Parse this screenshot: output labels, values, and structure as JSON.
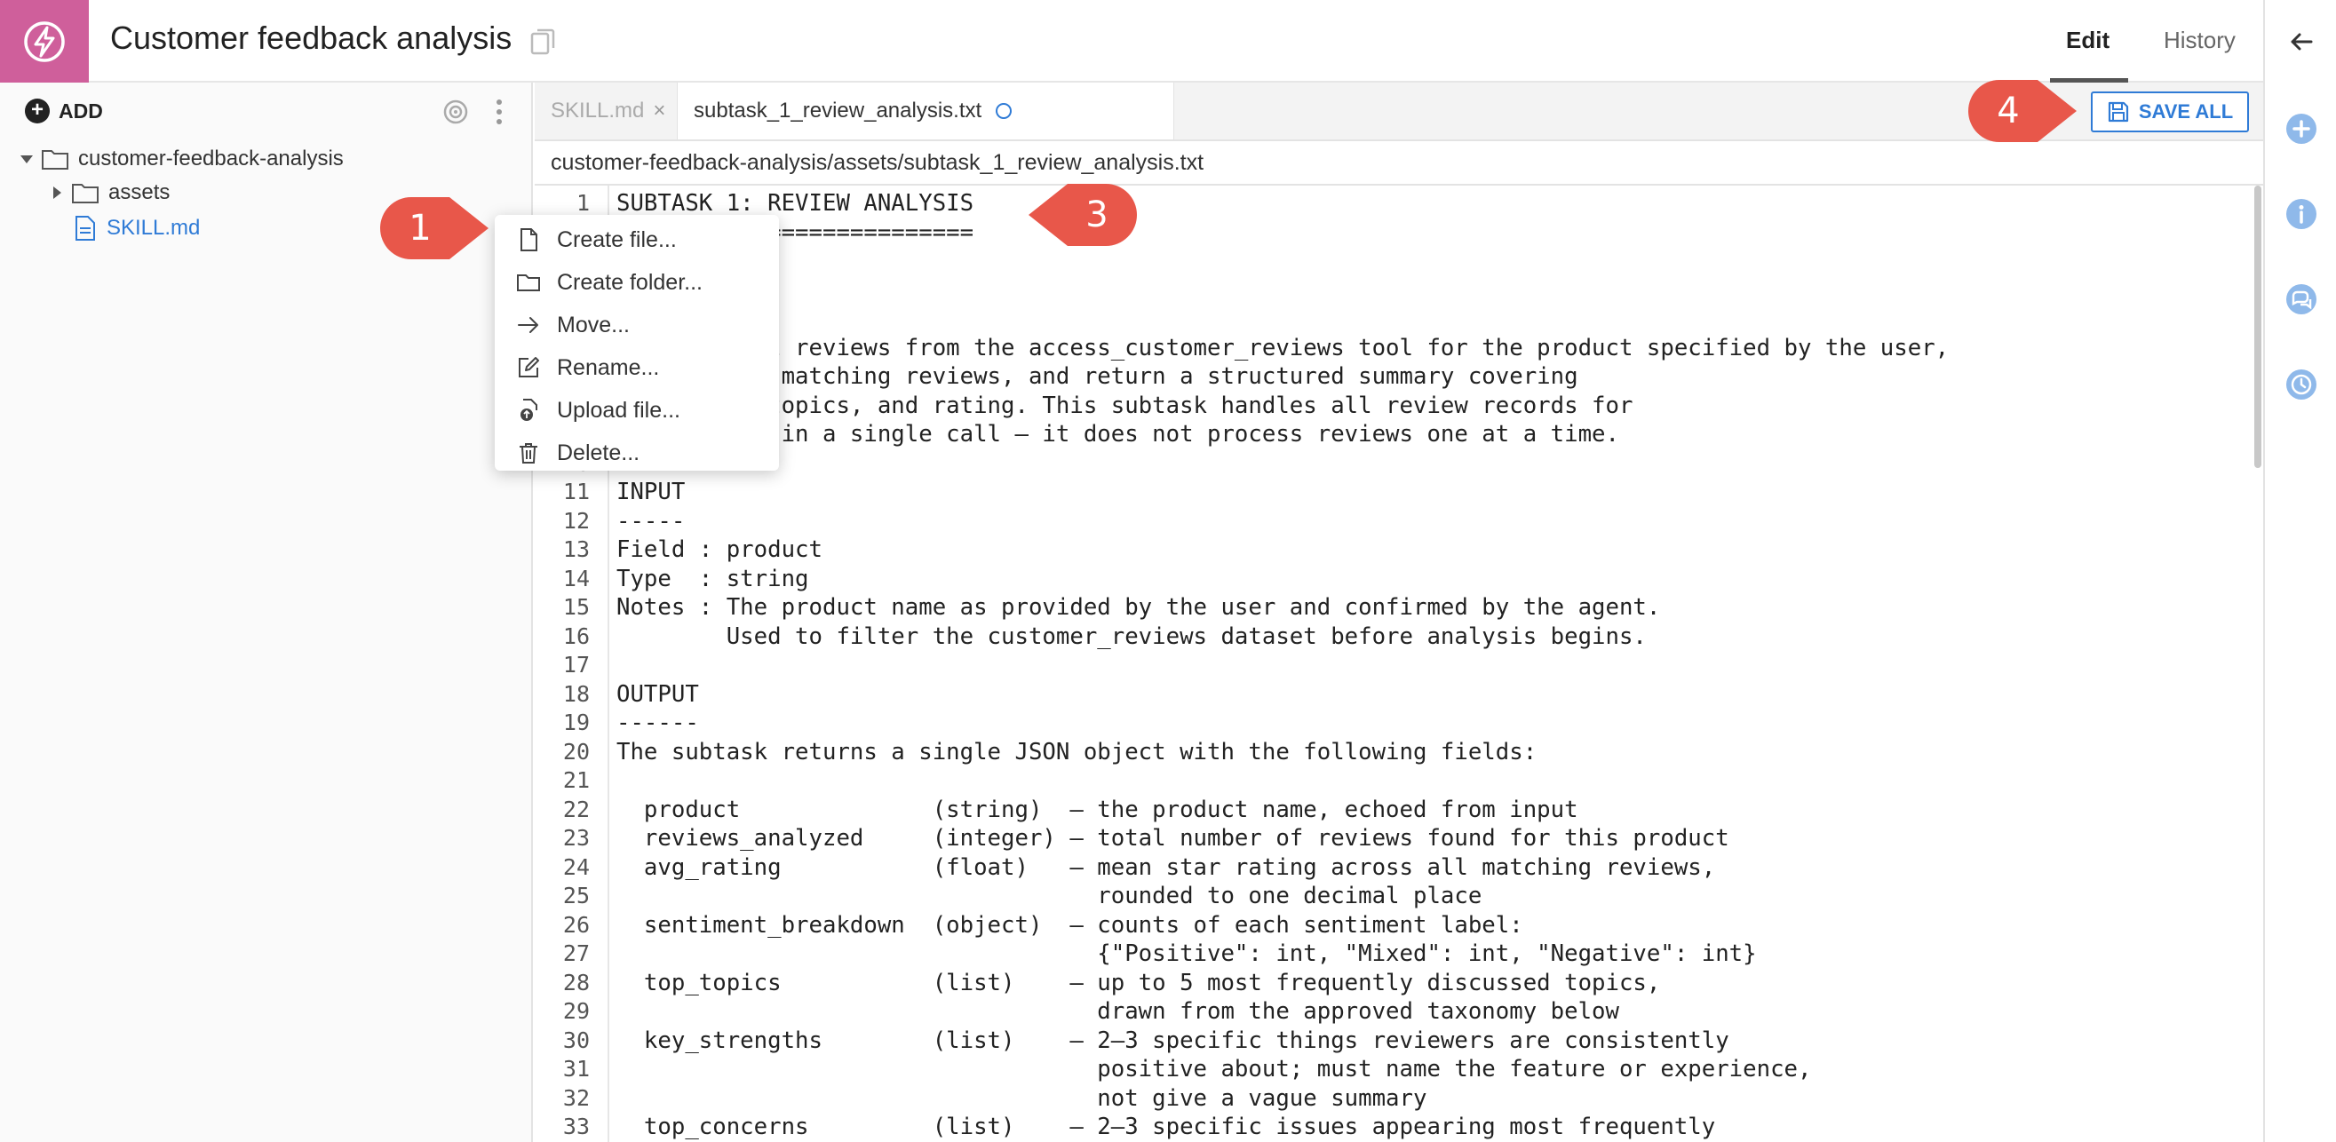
{
  "header": {
    "title": "Customer feedback analysis",
    "tabs": [
      {
        "label": "Edit",
        "active": true
      },
      {
        "label": "History",
        "active": false
      }
    ]
  },
  "sidebar": {
    "add_label": "ADD",
    "tree": [
      {
        "label": "customer-feedback-analysis",
        "type": "folder",
        "expanded": true
      },
      {
        "label": "assets",
        "type": "folder",
        "expanded": false
      },
      {
        "label": "SKILL.md",
        "type": "file",
        "selected": true
      }
    ]
  },
  "context_menu": {
    "items": [
      {
        "label": "Create file...",
        "icon": "file-icon"
      },
      {
        "label": "Create folder...",
        "icon": "folder-icon"
      },
      {
        "label": "Move...",
        "icon": "arrow-right-icon"
      },
      {
        "label": "Rename...",
        "icon": "edit-icon"
      },
      {
        "label": "Upload file...",
        "icon": "upload-icon"
      },
      {
        "label": "Delete...",
        "icon": "trash-icon"
      }
    ]
  },
  "editor": {
    "tabs": [
      {
        "label": "SKILL.md",
        "active": false
      },
      {
        "label": "subtask_1_review_analysis.txt",
        "active": true,
        "unsaved": true
      }
    ],
    "save_all_label": "SAVE ALL",
    "path": "customer-feedback-analysis/assets/subtask_1_review_analysis.txt",
    "lines": [
      {
        "n": "1",
        "text": "SUBTASK 1: REVIEW ANALYSIS"
      },
      {
        "n": "2",
        "text": "=========================="
      },
      {
        "n": "",
        "text": ""
      },
      {
        "n": "",
        "text": ""
      },
      {
        "n": "",
        "text": ""
      },
      {
        "n": "",
        "text": "Retrieve all reviews from the access_customer_reviews tool for the product specified by the user,"
      },
      {
        "n": "",
        "text": "analyze the matching reviews, and return a structured summary covering"
      },
      {
        "n": "",
        "text": "sentiment, topics, and rating. This subtask handles all review records for"
      },
      {
        "n": "",
        "text": "the product in a single call — it does not process reviews one at a time."
      },
      {
        "n": "10",
        "text": ""
      },
      {
        "n": "11",
        "text": "INPUT"
      },
      {
        "n": "12",
        "text": "-----"
      },
      {
        "n": "13",
        "text": "Field : product"
      },
      {
        "n": "14",
        "text": "Type  : string"
      },
      {
        "n": "15",
        "text": "Notes : The product name as provided by the user and confirmed by the agent."
      },
      {
        "n": "16",
        "text": "        Used to filter the customer_reviews dataset before analysis begins."
      },
      {
        "n": "17",
        "text": ""
      },
      {
        "n": "18",
        "text": "OUTPUT"
      },
      {
        "n": "19",
        "text": "------"
      },
      {
        "n": "20",
        "text": "The subtask returns a single JSON object with the following fields:"
      },
      {
        "n": "21",
        "text": ""
      },
      {
        "n": "22",
        "text": "  product              (string)  — the product name, echoed from input"
      },
      {
        "n": "23",
        "text": "  reviews_analyzed     (integer) — total number of reviews found for this product"
      },
      {
        "n": "24",
        "text": "  avg_rating           (float)   — mean star rating across all matching reviews,"
      },
      {
        "n": "25",
        "text": "                                   rounded to one decimal place"
      },
      {
        "n": "26",
        "text": "  sentiment_breakdown  (object)  — counts of each sentiment label:"
      },
      {
        "n": "27",
        "text": "                                   {\"Positive\": int, \"Mixed\": int, \"Negative\": int}"
      },
      {
        "n": "28",
        "text": "  top_topics           (list)    — up to 5 most frequently discussed topics,"
      },
      {
        "n": "29",
        "text": "                                   drawn from the approved taxonomy below"
      },
      {
        "n": "30",
        "text": "  key_strengths        (list)    — 2–3 specific things reviewers are consistently"
      },
      {
        "n": "31",
        "text": "                                   positive about; must name the feature or experience,"
      },
      {
        "n": "32",
        "text": "                                   not give a vague summary"
      },
      {
        "n": "33",
        "text": "  top_concerns         (list)    — 2–3 specific issues appearing most frequently"
      }
    ]
  },
  "callouts": [
    "1",
    "3",
    "4"
  ],
  "colors": {
    "brand": "#cf5f9b",
    "accent": "#2f7bd6",
    "callout": "#e8574a"
  }
}
